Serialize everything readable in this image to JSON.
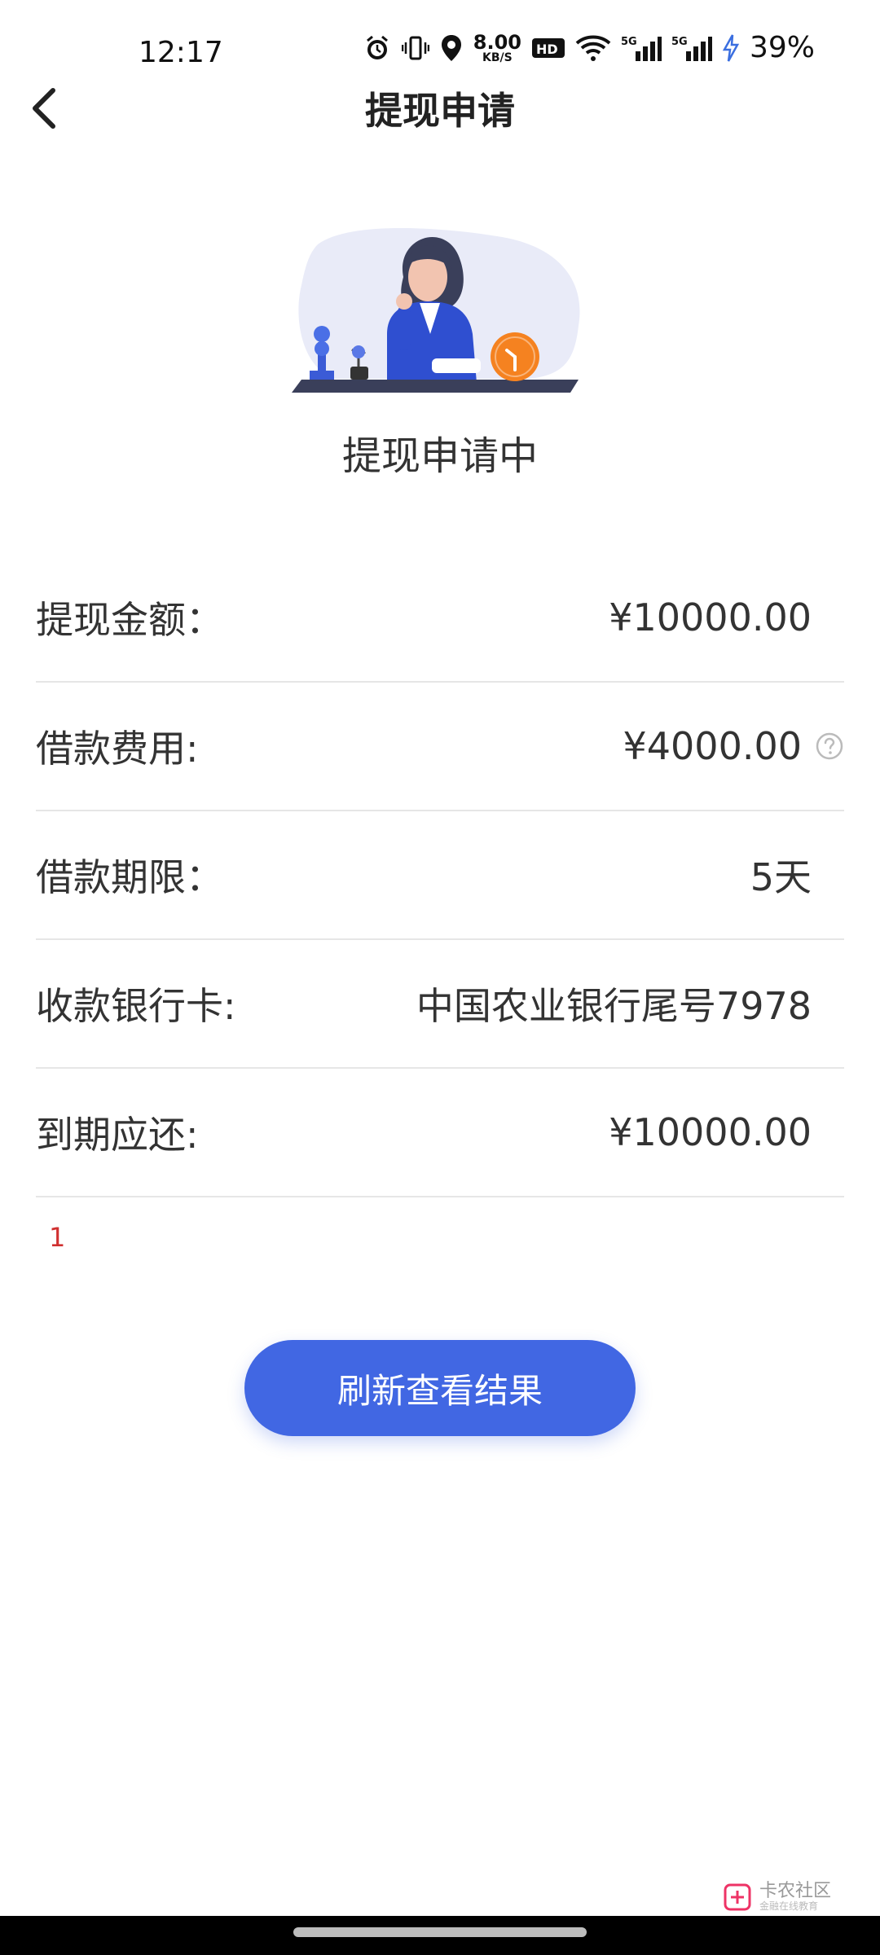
{
  "status_bar": {
    "time": "12:17",
    "net_speed": "8.00",
    "net_unit": "KB/S",
    "battery": "39%"
  },
  "header": {
    "title": "提现申请"
  },
  "status_text": "提现申请中",
  "info": {
    "rows": [
      {
        "label": "提现金额：",
        "value": "¥10000.00"
      },
      {
        "label": "借款费用:",
        "value": "¥4000.00"
      },
      {
        "label": "借款期限：",
        "value": "5天"
      },
      {
        "label": "收款银行卡:",
        "value": "中国农业银行尾号7978"
      },
      {
        "label": "到期应还:",
        "value": "¥10000.00"
      }
    ]
  },
  "note": "1",
  "button": {
    "refresh_label": "刷新查看结果"
  },
  "watermark": {
    "main": "卡农社区",
    "sub": "金融在线教育"
  },
  "colors": {
    "accent": "#4167e3",
    "note_red": "#d03030",
    "divider": "#e6e6e6"
  }
}
